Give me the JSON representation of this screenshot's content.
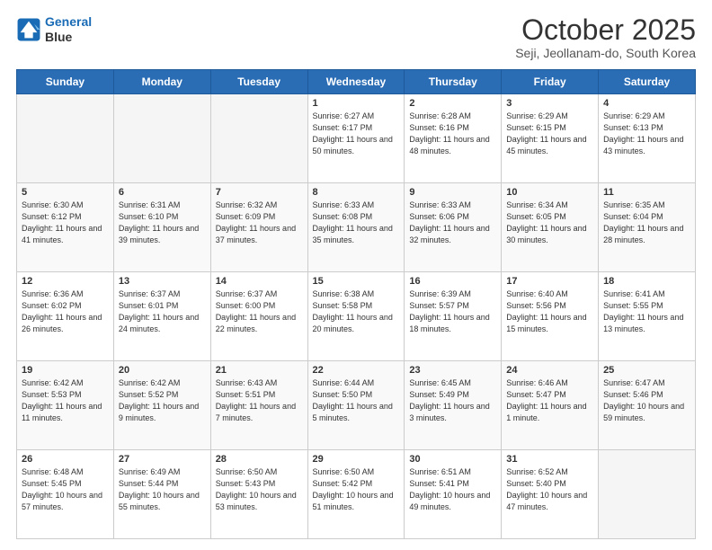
{
  "header": {
    "logo_line1": "General",
    "logo_line2": "Blue",
    "month": "October 2025",
    "location": "Seji, Jeollanam-do, South Korea"
  },
  "days_of_week": [
    "Sunday",
    "Monday",
    "Tuesday",
    "Wednesday",
    "Thursday",
    "Friday",
    "Saturday"
  ],
  "weeks": [
    [
      {
        "day": "",
        "sunrise": "",
        "sunset": "",
        "daylight": "",
        "empty": true
      },
      {
        "day": "",
        "sunrise": "",
        "sunset": "",
        "daylight": "",
        "empty": true
      },
      {
        "day": "",
        "sunrise": "",
        "sunset": "",
        "daylight": "",
        "empty": true
      },
      {
        "day": "1",
        "sunrise": "Sunrise: 6:27 AM",
        "sunset": "Sunset: 6:17 PM",
        "daylight": "Daylight: 11 hours and 50 minutes.",
        "empty": false
      },
      {
        "day": "2",
        "sunrise": "Sunrise: 6:28 AM",
        "sunset": "Sunset: 6:16 PM",
        "daylight": "Daylight: 11 hours and 48 minutes.",
        "empty": false
      },
      {
        "day": "3",
        "sunrise": "Sunrise: 6:29 AM",
        "sunset": "Sunset: 6:15 PM",
        "daylight": "Daylight: 11 hours and 45 minutes.",
        "empty": false
      },
      {
        "day": "4",
        "sunrise": "Sunrise: 6:29 AM",
        "sunset": "Sunset: 6:13 PM",
        "daylight": "Daylight: 11 hours and 43 minutes.",
        "empty": false
      }
    ],
    [
      {
        "day": "5",
        "sunrise": "Sunrise: 6:30 AM",
        "sunset": "Sunset: 6:12 PM",
        "daylight": "Daylight: 11 hours and 41 minutes.",
        "empty": false
      },
      {
        "day": "6",
        "sunrise": "Sunrise: 6:31 AM",
        "sunset": "Sunset: 6:10 PM",
        "daylight": "Daylight: 11 hours and 39 minutes.",
        "empty": false
      },
      {
        "day": "7",
        "sunrise": "Sunrise: 6:32 AM",
        "sunset": "Sunset: 6:09 PM",
        "daylight": "Daylight: 11 hours and 37 minutes.",
        "empty": false
      },
      {
        "day": "8",
        "sunrise": "Sunrise: 6:33 AM",
        "sunset": "Sunset: 6:08 PM",
        "daylight": "Daylight: 11 hours and 35 minutes.",
        "empty": false
      },
      {
        "day": "9",
        "sunrise": "Sunrise: 6:33 AM",
        "sunset": "Sunset: 6:06 PM",
        "daylight": "Daylight: 11 hours and 32 minutes.",
        "empty": false
      },
      {
        "day": "10",
        "sunrise": "Sunrise: 6:34 AM",
        "sunset": "Sunset: 6:05 PM",
        "daylight": "Daylight: 11 hours and 30 minutes.",
        "empty": false
      },
      {
        "day": "11",
        "sunrise": "Sunrise: 6:35 AM",
        "sunset": "Sunset: 6:04 PM",
        "daylight": "Daylight: 11 hours and 28 minutes.",
        "empty": false
      }
    ],
    [
      {
        "day": "12",
        "sunrise": "Sunrise: 6:36 AM",
        "sunset": "Sunset: 6:02 PM",
        "daylight": "Daylight: 11 hours and 26 minutes.",
        "empty": false
      },
      {
        "day": "13",
        "sunrise": "Sunrise: 6:37 AM",
        "sunset": "Sunset: 6:01 PM",
        "daylight": "Daylight: 11 hours and 24 minutes.",
        "empty": false
      },
      {
        "day": "14",
        "sunrise": "Sunrise: 6:37 AM",
        "sunset": "Sunset: 6:00 PM",
        "daylight": "Daylight: 11 hours and 22 minutes.",
        "empty": false
      },
      {
        "day": "15",
        "sunrise": "Sunrise: 6:38 AM",
        "sunset": "Sunset: 5:58 PM",
        "daylight": "Daylight: 11 hours and 20 minutes.",
        "empty": false
      },
      {
        "day": "16",
        "sunrise": "Sunrise: 6:39 AM",
        "sunset": "Sunset: 5:57 PM",
        "daylight": "Daylight: 11 hours and 18 minutes.",
        "empty": false
      },
      {
        "day": "17",
        "sunrise": "Sunrise: 6:40 AM",
        "sunset": "Sunset: 5:56 PM",
        "daylight": "Daylight: 11 hours and 15 minutes.",
        "empty": false
      },
      {
        "day": "18",
        "sunrise": "Sunrise: 6:41 AM",
        "sunset": "Sunset: 5:55 PM",
        "daylight": "Daylight: 11 hours and 13 minutes.",
        "empty": false
      }
    ],
    [
      {
        "day": "19",
        "sunrise": "Sunrise: 6:42 AM",
        "sunset": "Sunset: 5:53 PM",
        "daylight": "Daylight: 11 hours and 11 minutes.",
        "empty": false
      },
      {
        "day": "20",
        "sunrise": "Sunrise: 6:42 AM",
        "sunset": "Sunset: 5:52 PM",
        "daylight": "Daylight: 11 hours and 9 minutes.",
        "empty": false
      },
      {
        "day": "21",
        "sunrise": "Sunrise: 6:43 AM",
        "sunset": "Sunset: 5:51 PM",
        "daylight": "Daylight: 11 hours and 7 minutes.",
        "empty": false
      },
      {
        "day": "22",
        "sunrise": "Sunrise: 6:44 AM",
        "sunset": "Sunset: 5:50 PM",
        "daylight": "Daylight: 11 hours and 5 minutes.",
        "empty": false
      },
      {
        "day": "23",
        "sunrise": "Sunrise: 6:45 AM",
        "sunset": "Sunset: 5:49 PM",
        "daylight": "Daylight: 11 hours and 3 minutes.",
        "empty": false
      },
      {
        "day": "24",
        "sunrise": "Sunrise: 6:46 AM",
        "sunset": "Sunset: 5:47 PM",
        "daylight": "Daylight: 11 hours and 1 minute.",
        "empty": false
      },
      {
        "day": "25",
        "sunrise": "Sunrise: 6:47 AM",
        "sunset": "Sunset: 5:46 PM",
        "daylight": "Daylight: 10 hours and 59 minutes.",
        "empty": false
      }
    ],
    [
      {
        "day": "26",
        "sunrise": "Sunrise: 6:48 AM",
        "sunset": "Sunset: 5:45 PM",
        "daylight": "Daylight: 10 hours and 57 minutes.",
        "empty": false
      },
      {
        "day": "27",
        "sunrise": "Sunrise: 6:49 AM",
        "sunset": "Sunset: 5:44 PM",
        "daylight": "Daylight: 10 hours and 55 minutes.",
        "empty": false
      },
      {
        "day": "28",
        "sunrise": "Sunrise: 6:50 AM",
        "sunset": "Sunset: 5:43 PM",
        "daylight": "Daylight: 10 hours and 53 minutes.",
        "empty": false
      },
      {
        "day": "29",
        "sunrise": "Sunrise: 6:50 AM",
        "sunset": "Sunset: 5:42 PM",
        "daylight": "Daylight: 10 hours and 51 minutes.",
        "empty": false
      },
      {
        "day": "30",
        "sunrise": "Sunrise: 6:51 AM",
        "sunset": "Sunset: 5:41 PM",
        "daylight": "Daylight: 10 hours and 49 minutes.",
        "empty": false
      },
      {
        "day": "31",
        "sunrise": "Sunrise: 6:52 AM",
        "sunset": "Sunset: 5:40 PM",
        "daylight": "Daylight: 10 hours and 47 minutes.",
        "empty": false
      },
      {
        "day": "",
        "sunrise": "",
        "sunset": "",
        "daylight": "",
        "empty": true
      }
    ]
  ]
}
